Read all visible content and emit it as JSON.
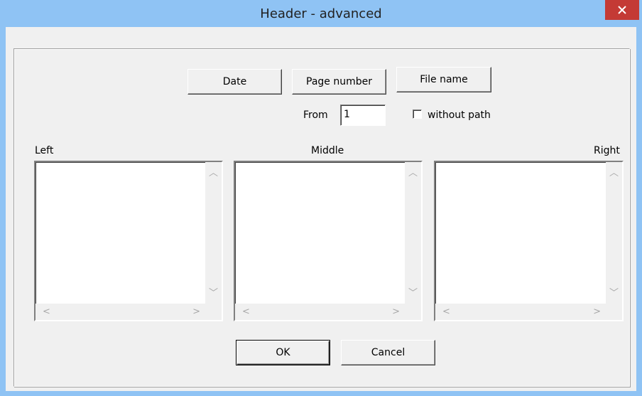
{
  "window": {
    "title": "Header - advanced",
    "close_glyph": "✕"
  },
  "insert_buttons": {
    "date": "Date",
    "page_number": "Page number",
    "file_name": "File name"
  },
  "from": {
    "label": "From",
    "value": "1"
  },
  "without_path": {
    "label": "without path",
    "checked": false
  },
  "sections": {
    "left": {
      "label": "Left",
      "value": ""
    },
    "middle": {
      "label": "Middle",
      "value": ""
    },
    "right": {
      "label": "Right",
      "value": ""
    }
  },
  "scroll_glyphs": {
    "up": "︿",
    "down": "﹀",
    "left": "<",
    "right": ">"
  },
  "footer": {
    "ok": "OK",
    "cancel": "Cancel"
  },
  "colors": {
    "titlebar": "#8fc3f4",
    "close_button": "#c43a35",
    "dialog_face": "#f0f0f0"
  }
}
